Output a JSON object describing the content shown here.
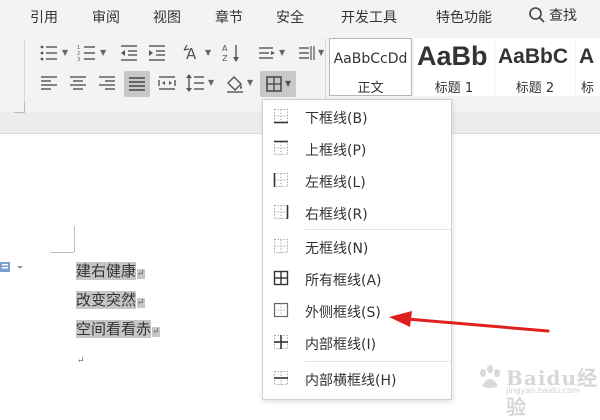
{
  "menubar": {
    "items": [
      "引用",
      "审阅",
      "视图",
      "章节",
      "安全",
      "开发工具",
      "特色功能"
    ],
    "search_label": "查找"
  },
  "styles": {
    "items": [
      {
        "sample": "AaBbCcDd",
        "name": "正文"
      },
      {
        "sample": "AaBb",
        "name": "标题 1"
      },
      {
        "sample": "AaBbC",
        "name": "标题 2"
      },
      {
        "sample": "A",
        "name": "标"
      }
    ]
  },
  "document": {
    "lines": [
      "建右健康",
      "改变突然",
      "空间看看赤"
    ],
    "para_mark": "↵"
  },
  "border_menu": {
    "items": [
      {
        "label": "下框线(B)",
        "icon": "bottom-border-icon"
      },
      {
        "label": "上框线(P)",
        "icon": "top-border-icon"
      },
      {
        "label": "左框线(L)",
        "icon": "left-border-icon"
      },
      {
        "label": "右框线(R)",
        "icon": "right-border-icon"
      },
      {
        "label": "无框线(N)",
        "icon": "no-border-icon"
      },
      {
        "label": "所有框线(A)",
        "icon": "all-borders-icon"
      },
      {
        "label": "外侧框线(S)",
        "icon": "outside-borders-icon"
      },
      {
        "label": "内部框线(I)",
        "icon": "inside-borders-icon"
      },
      {
        "label": "内部横框线(H)",
        "icon": "inside-horizontal-border-icon"
      }
    ]
  },
  "watermark": {
    "text": "Baidu经验",
    "url": "jingyan.baidu.com"
  },
  "colors": {
    "annotation_arrow": "#e02020",
    "selection": "#c6c6c6",
    "ribbon_bg": "#f3f3f3"
  }
}
